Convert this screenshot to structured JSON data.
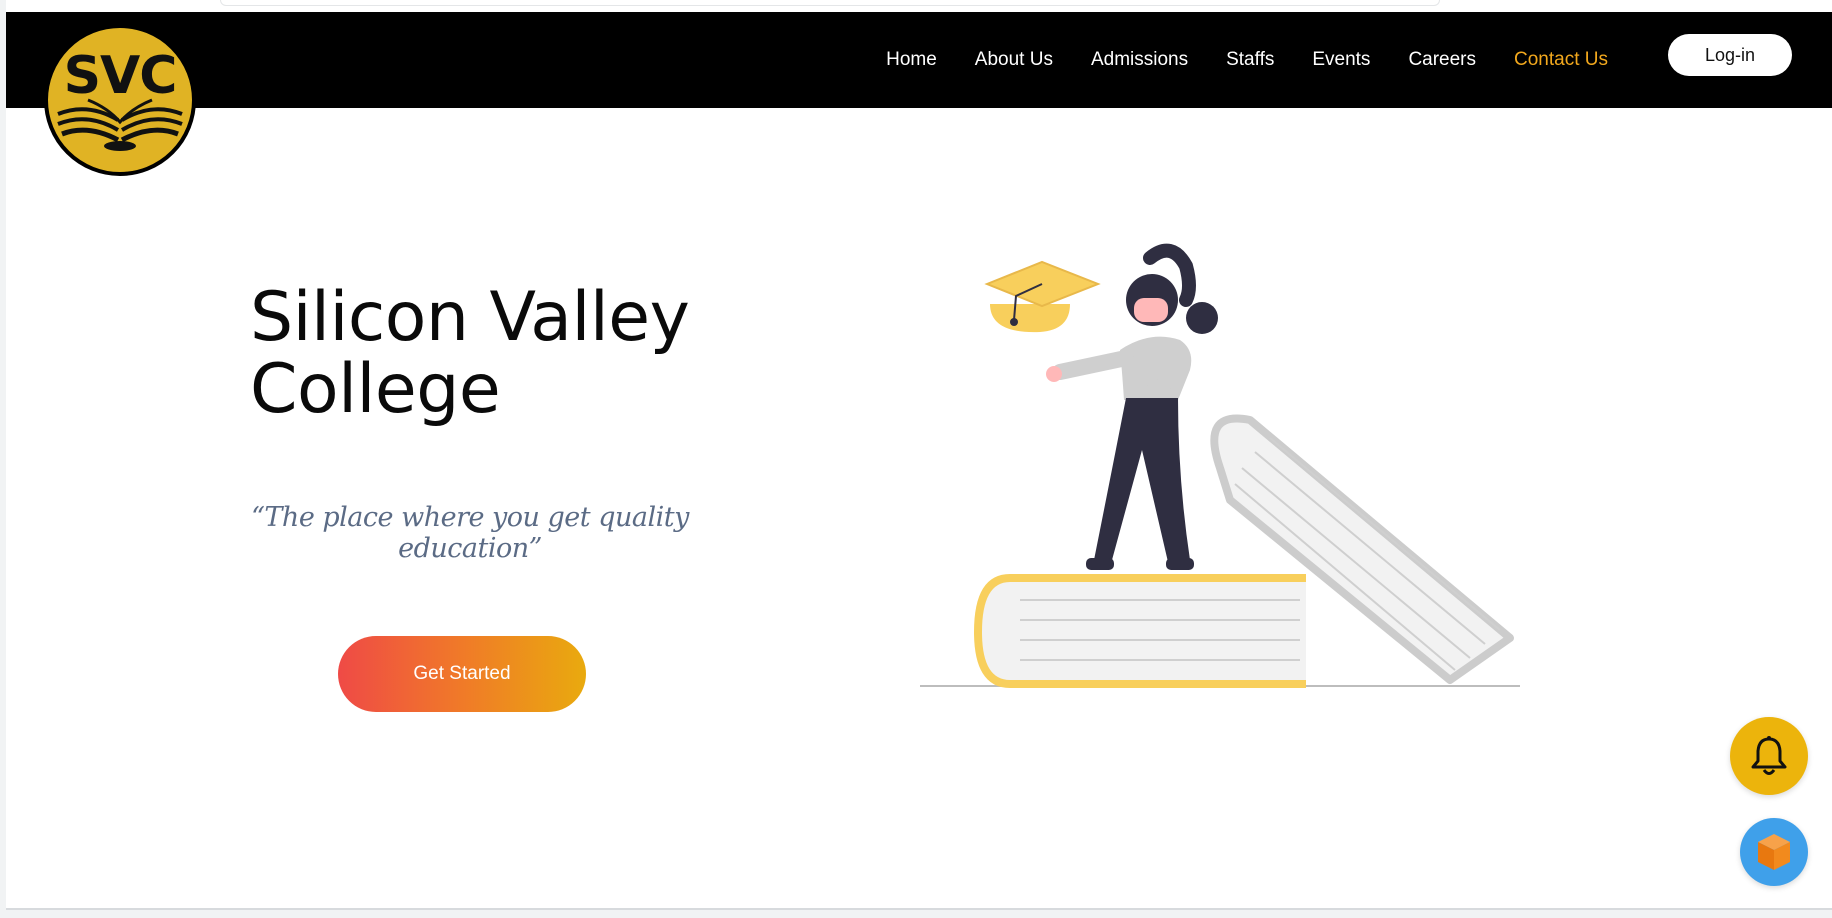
{
  "logo": {
    "text": "SVC",
    "icon": "open-book-logo-icon"
  },
  "nav": {
    "items": [
      {
        "label": "Home"
      },
      {
        "label": "About Us"
      },
      {
        "label": "Admissions"
      },
      {
        "label": "Staffs"
      },
      {
        "label": "Events"
      },
      {
        "label": "Careers"
      },
      {
        "label": "Contact Us",
        "active": true
      }
    ],
    "login_label": "Log-in"
  },
  "hero": {
    "title_line1": "Silicon Valley",
    "title_line2": "College",
    "tagline": "“The place where you get quality education”",
    "cta_label": "Get Started"
  },
  "widgets": {
    "bell_icon": "bell-icon",
    "cube_icon": "cube-icon"
  },
  "colors": {
    "navbar": "#000000",
    "accent": "#f2a81d",
    "logo": "#e0b324",
    "cta_start": "#ef4a46",
    "cta_end": "#e9aa0e",
    "bell_fab": "#ecb40c",
    "cube_fab": "#3fa0ea"
  }
}
